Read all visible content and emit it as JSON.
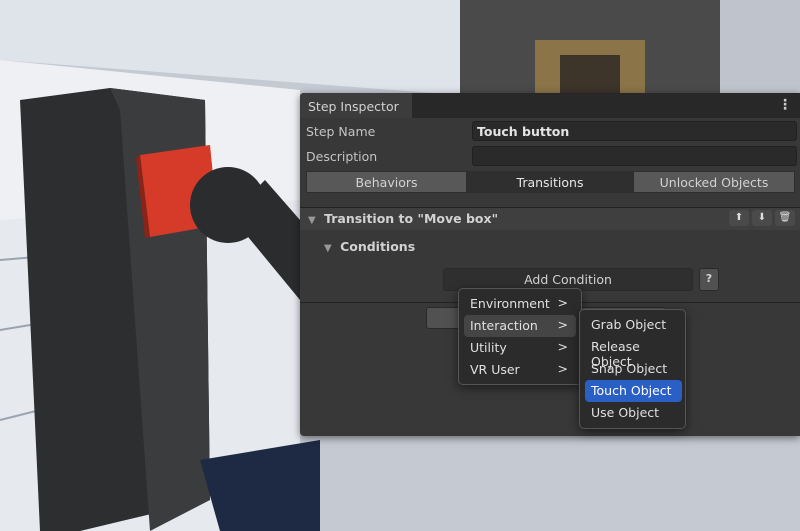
{
  "panel": {
    "tab": "Step Inspector",
    "menu_icon": "kebab-icon",
    "step_name_label": "Step Name",
    "step_name_value": "Touch button",
    "description_label": "Description",
    "description_value": "",
    "tabs": [
      {
        "label": "Behaviors",
        "selected": false
      },
      {
        "label": "Transitions",
        "selected": true
      },
      {
        "label": "Unlocked Objects",
        "selected": false
      }
    ],
    "transition_title": "Transition to \"Move box\"",
    "conditions_label": "Conditions",
    "add_condition": "Add Condition",
    "help": "?"
  },
  "menu": {
    "items": [
      {
        "label": "Environment"
      },
      {
        "label": "Interaction"
      },
      {
        "label": "Utility"
      },
      {
        "label": "VR User"
      }
    ],
    "arrow": ">"
  },
  "submenu": {
    "items": [
      {
        "label": "Grab Object"
      },
      {
        "label": "Release Object"
      },
      {
        "label": "Snap Object"
      },
      {
        "label": "Touch Object"
      },
      {
        "label": "Use Object"
      }
    ],
    "selected": "Touch Object"
  }
}
